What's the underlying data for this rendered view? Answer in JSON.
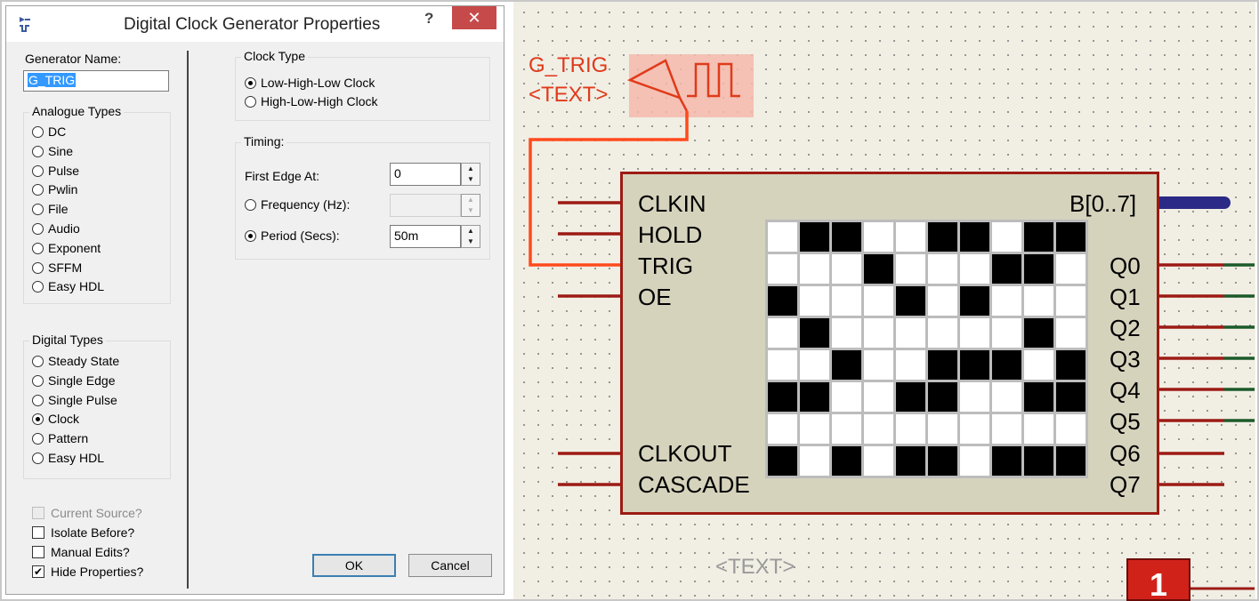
{
  "dialog": {
    "title": "Digital Clock Generator Properties",
    "help_label": "?",
    "close_label": "✕",
    "generator_name_label": "Generator Name:",
    "generator_name_value": "G_TRIG",
    "analogue_types": {
      "label": "Analogue Types",
      "options": [
        "DC",
        "Sine",
        "Pulse",
        "Pwlin",
        "File",
        "Audio",
        "Exponent",
        "SFFM",
        "Easy HDL"
      ]
    },
    "digital_types": {
      "label": "Digital Types",
      "options": [
        "Steady State",
        "Single Edge",
        "Single Pulse",
        "Clock",
        "Pattern",
        "Easy HDL"
      ],
      "selected": "Clock"
    },
    "checkboxes": {
      "current_source": {
        "label": "Current Source?",
        "checked": false,
        "disabled": true
      },
      "isolate_before": {
        "label": "Isolate Before?",
        "checked": false
      },
      "manual_edits": {
        "label": "Manual Edits?",
        "checked": false
      },
      "hide_properties": {
        "label": "Hide Properties?",
        "checked": true
      }
    },
    "clock_type": {
      "label": "Clock Type",
      "options": [
        "Low-High-Low Clock",
        "High-Low-High Clock"
      ],
      "selected": "Low-High-Low Clock"
    },
    "timing": {
      "label": "Timing:",
      "first_edge_label": "First Edge At:",
      "first_edge_value": "0",
      "frequency_label": "Frequency (Hz):",
      "frequency_value": "",
      "period_label": "Period (Secs):",
      "period_value": "50m",
      "selected": "Period (Secs)"
    },
    "ok_label": "OK",
    "cancel_label": "Cancel"
  },
  "schematic": {
    "generator_name": "G_TRIG",
    "generator_text": "<TEXT>",
    "chip_text": "<TEXT>",
    "bus_label": "B[0..7]",
    "left_pins": [
      "CLKIN",
      "HOLD",
      "TRIG",
      "OE"
    ],
    "left_pins_bottom": [
      "CLKOUT",
      "CASCADE"
    ],
    "right_pins": [
      "Q0",
      "Q1",
      "Q2",
      "Q3",
      "Q4",
      "Q5",
      "Q6",
      "Q7"
    ],
    "marker_label": "1",
    "matrix": [
      [
        0,
        1,
        1,
        0,
        0,
        1,
        1,
        0,
        1,
        1
      ],
      [
        0,
        0,
        0,
        1,
        0,
        0,
        0,
        1,
        1,
        0
      ],
      [
        1,
        0,
        0,
        0,
        1,
        0,
        1,
        0,
        0,
        0
      ],
      [
        0,
        1,
        0,
        0,
        0,
        0,
        0,
        0,
        1,
        0
      ],
      [
        0,
        0,
        1,
        0,
        0,
        1,
        1,
        1,
        0,
        1
      ],
      [
        1,
        1,
        0,
        0,
        1,
        1,
        0,
        0,
        1,
        1
      ],
      [
        0,
        0,
        0,
        0,
        0,
        0,
        0,
        0,
        0,
        0
      ],
      [
        1,
        0,
        1,
        0,
        1,
        1,
        0,
        1,
        1,
        1
      ]
    ],
    "colors": {
      "wire": "#9c1b14",
      "trig_wire": "#ff4a1c",
      "bus": "#2b2a86",
      "output_tail": "#1c5a2a",
      "generator_highlight": "#f5b8ab"
    }
  }
}
